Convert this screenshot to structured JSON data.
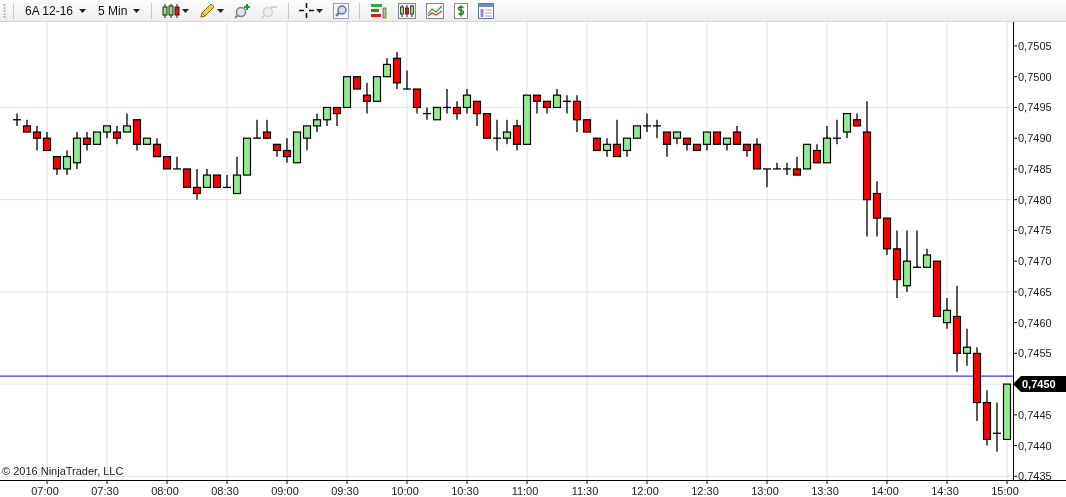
{
  "toolbar": {
    "instrument": {
      "label": "6A 12-16"
    },
    "interval": {
      "label": "5 Min"
    },
    "tool_groups": [
      [
        {
          "kind": "chart-style",
          "menu": true,
          "disabled": false
        },
        {
          "kind": "draw",
          "menu": true,
          "disabled": false
        },
        {
          "kind": "zoom-in",
          "menu": false,
          "disabled": false
        },
        {
          "kind": "zoom-out",
          "menu": false,
          "disabled": true
        }
      ],
      [
        {
          "kind": "crosshair",
          "menu": true,
          "disabled": false
        },
        {
          "kind": "zoom-box",
          "menu": false,
          "disabled": false
        }
      ],
      [
        {
          "kind": "indicators",
          "menu": false,
          "disabled": false
        },
        {
          "kind": "strategies",
          "menu": false,
          "disabled": false
        },
        {
          "kind": "line-chart",
          "menu": false,
          "disabled": false
        },
        {
          "kind": "dollar",
          "menu": false,
          "disabled": false
        },
        {
          "kind": "properties",
          "menu": false,
          "disabled": false
        }
      ]
    ]
  },
  "chart": {
    "copyright": "© 2016 NinjaTrader, LLC",
    "last_price": {
      "label": "0,7450"
    },
    "chart_data": {
      "type": "candlestick",
      "grid": true,
      "ylim": [
        0.74344,
        0.75089
      ],
      "yticks": [
        {
          "value": 0.7435,
          "label": "0,7435"
        },
        {
          "value": 0.744,
          "label": "0,7440"
        },
        {
          "value": 0.7445,
          "label": "0,7445"
        },
        {
          "value": 0.7455,
          "label": "0,7455"
        },
        {
          "value": 0.746,
          "label": "0,7460"
        },
        {
          "value": 0.7465,
          "label": "0,7465"
        },
        {
          "value": 0.747,
          "label": "0,7470"
        },
        {
          "value": 0.7475,
          "label": "0,7475"
        },
        {
          "value": 0.748,
          "label": "0,7480"
        },
        {
          "value": 0.7485,
          "label": "0,7485"
        },
        {
          "value": 0.749,
          "label": "0,7490"
        },
        {
          "value": 0.7495,
          "label": "0,7495"
        },
        {
          "value": 0.75,
          "label": "0,7500"
        },
        {
          "value": 0.7505,
          "label": "0,7505"
        }
      ],
      "categories": [
        null,
        null,
        null,
        "07:00",
        null,
        null,
        null,
        null,
        null,
        "07:30",
        null,
        null,
        null,
        null,
        null,
        "08:00",
        null,
        null,
        null,
        null,
        null,
        "08:30",
        null,
        null,
        null,
        null,
        null,
        "09:00",
        null,
        null,
        null,
        null,
        null,
        "09:30",
        null,
        null,
        null,
        null,
        null,
        "10:00",
        null,
        null,
        null,
        null,
        null,
        "10:30",
        null,
        null,
        null,
        null,
        null,
        "11:00",
        null,
        null,
        null,
        null,
        null,
        "11:30",
        null,
        null,
        null,
        null,
        null,
        "12:00",
        null,
        null,
        null,
        null,
        null,
        "12:30",
        null,
        null,
        null,
        null,
        null,
        "13:00",
        null,
        null,
        null,
        null,
        null,
        "13:30",
        null,
        null,
        null,
        null,
        null,
        "14:00",
        null,
        null,
        null,
        null,
        null,
        "14:30",
        null,
        null,
        null,
        null,
        null,
        "15:00"
      ],
      "ohlc": [
        [
          0.7493,
          0.7494,
          0.7492,
          0.7493
        ],
        [
          0.7492,
          0.7493,
          0.7491,
          0.7491
        ],
        [
          0.7491,
          0.7492,
          0.7488,
          0.749
        ],
        [
          0.749,
          0.7491,
          0.7488,
          0.7488
        ],
        [
          0.7487,
          0.7487,
          0.7484,
          0.7485
        ],
        [
          0.7485,
          0.7488,
          0.7484,
          0.7487
        ],
        [
          0.7486,
          0.7491,
          0.7485,
          0.749
        ],
        [
          0.749,
          0.7491,
          0.7488,
          0.7489
        ],
        [
          0.7489,
          0.7491,
          0.7489,
          0.7491
        ],
        [
          0.7491,
          0.7492,
          0.749,
          0.7492
        ],
        [
          0.7491,
          0.7492,
          0.7489,
          0.749
        ],
        [
          0.7491,
          0.7494,
          0.7491,
          0.7492
        ],
        [
          0.7493,
          0.7493,
          0.7488,
          0.7489
        ],
        [
          0.7489,
          0.749,
          0.7489,
          0.749
        ],
        [
          0.7489,
          0.749,
          0.7487,
          0.7487
        ],
        [
          0.7487,
          0.7487,
          0.7485,
          0.7485
        ],
        [
          0.7485,
          0.7487,
          0.7485,
          0.7485
        ],
        [
          0.7485,
          0.7485,
          0.7482,
          0.7482
        ],
        [
          0.7482,
          0.7485,
          0.748,
          0.7481
        ],
        [
          0.7482,
          0.7485,
          0.7482,
          0.7484
        ],
        [
          0.7484,
          0.7484,
          0.7482,
          0.7482
        ],
        [
          0.7482,
          0.7484,
          0.7482,
          0.7482
        ],
        [
          0.7481,
          0.7487,
          0.7481,
          0.7484
        ],
        [
          0.7484,
          0.749,
          0.7484,
          0.749
        ],
        [
          0.749,
          0.7493,
          0.749,
          0.749
        ],
        [
          0.7491,
          0.7493,
          0.749,
          0.749
        ],
        [
          0.7489,
          0.7489,
          0.7487,
          0.7488
        ],
        [
          0.7488,
          0.749,
          0.7486,
          0.7487
        ],
        [
          0.7486,
          0.7491,
          0.7486,
          0.7491
        ],
        [
          0.749,
          0.7492,
          0.7488,
          0.7492
        ],
        [
          0.7492,
          0.7494,
          0.7491,
          0.7493
        ],
        [
          0.7493,
          0.7495,
          0.7492,
          0.7495
        ],
        [
          0.7495,
          0.7495,
          0.7492,
          0.7494
        ],
        [
          0.7495,
          0.75,
          0.7495,
          0.75
        ],
        [
          0.75,
          0.75,
          0.7498,
          0.7498
        ],
        [
          0.7497,
          0.7499,
          0.7494,
          0.7496
        ],
        [
          0.7496,
          0.75,
          0.7496,
          0.75
        ],
        [
          0.75,
          0.7503,
          0.75,
          0.7502
        ],
        [
          0.7503,
          0.7504,
          0.7498,
          0.7499
        ],
        [
          0.7498,
          0.7501,
          0.7498,
          0.7498
        ],
        [
          0.7498,
          0.7498,
          0.7494,
          0.7495
        ],
        [
          0.7494,
          0.7495,
          0.7493,
          0.7494
        ],
        [
          0.7493,
          0.7495,
          0.7493,
          0.7495
        ],
        [
          0.7495,
          0.7498,
          0.7494,
          0.7495
        ],
        [
          0.7495,
          0.7496,
          0.7493,
          0.7494
        ],
        [
          0.7495,
          0.7498,
          0.7494,
          0.7497
        ],
        [
          0.7496,
          0.7496,
          0.7492,
          0.7494
        ],
        [
          0.7494,
          0.7494,
          0.749,
          0.749
        ],
        [
          0.749,
          0.7493,
          0.7488,
          0.749
        ],
        [
          0.749,
          0.7493,
          0.7489,
          0.7491
        ],
        [
          0.7492,
          0.7493,
          0.7488,
          0.7489
        ],
        [
          0.7489,
          0.7497,
          0.7489,
          0.7497
        ],
        [
          0.7497,
          0.7497,
          0.7494,
          0.7496
        ],
        [
          0.7496,
          0.7496,
          0.7494,
          0.7495
        ],
        [
          0.7495,
          0.7498,
          0.7495,
          0.7497
        ],
        [
          0.7496,
          0.7497,
          0.7494,
          0.7496
        ],
        [
          0.7496,
          0.7497,
          0.7491,
          0.7493
        ],
        [
          0.7493,
          0.7493,
          0.7491,
          0.7491
        ],
        [
          0.749,
          0.749,
          0.7488,
          0.7488
        ],
        [
          0.7488,
          0.749,
          0.7487,
          0.7489
        ],
        [
          0.7489,
          0.7493,
          0.7487,
          0.7487
        ],
        [
          0.7488,
          0.749,
          0.7487,
          0.749
        ],
        [
          0.749,
          0.7492,
          0.749,
          0.7492
        ],
        [
          0.7492,
          0.7494,
          0.7491,
          0.7492
        ],
        [
          0.7492,
          0.7493,
          0.749,
          0.7492
        ],
        [
          0.7491,
          0.7491,
          0.7487,
          0.7489
        ],
        [
          0.749,
          0.7491,
          0.7489,
          0.7491
        ],
        [
          0.749,
          0.749,
          0.7488,
          0.7489
        ],
        [
          0.7489,
          0.7489,
          0.7488,
          0.7488
        ],
        [
          0.7489,
          0.7491,
          0.7488,
          0.7491
        ],
        [
          0.7491,
          0.7491,
          0.7489,
          0.7489
        ],
        [
          0.7489,
          0.749,
          0.7488,
          0.749
        ],
        [
          0.7491,
          0.7492,
          0.7489,
          0.7489
        ],
        [
          0.7489,
          0.7489,
          0.7487,
          0.7488
        ],
        [
          0.7489,
          0.749,
          0.7485,
          0.7485
        ],
        [
          0.7485,
          0.7485,
          0.7482,
          0.7485
        ],
        [
          0.7485,
          0.7486,
          0.7485,
          0.7485
        ],
        [
          0.7485,
          0.7486,
          0.7484,
          0.7485
        ],
        [
          0.7485,
          0.7487,
          0.7484,
          0.7484
        ],
        [
          0.7485,
          0.7489,
          0.7485,
          0.7489
        ],
        [
          0.7488,
          0.7489,
          0.7486,
          0.7486
        ],
        [
          0.7486,
          0.7492,
          0.7486,
          0.749
        ],
        [
          0.749,
          0.7493,
          0.7489,
          0.749
        ],
        [
          0.7491,
          0.7494,
          0.749,
          0.7494
        ],
        [
          0.7493,
          0.7494,
          0.7492,
          0.7492
        ],
        [
          0.7491,
          0.7496,
          0.7474,
          0.748
        ],
        [
          0.7481,
          0.7483,
          0.7474,
          0.7477
        ],
        [
          0.7477,
          0.7477,
          0.7471,
          0.7472
        ],
        [
          0.7472,
          0.7475,
          0.7464,
          0.7467
        ],
        [
          0.7466,
          0.7475,
          0.7465,
          0.747
        ],
        [
          0.7469,
          0.7475,
          0.7469,
          0.7469
        ],
        [
          0.7469,
          0.7472,
          0.7469,
          0.7471
        ],
        [
          0.747,
          0.747,
          0.7461,
          0.7461
        ],
        [
          0.746,
          0.7464,
          0.7459,
          0.7462
        ],
        [
          0.7461,
          0.7466,
          0.7452,
          0.7455
        ],
        [
          0.7455,
          0.7459,
          0.7453,
          0.7456
        ],
        [
          0.7455,
          0.7456,
          0.7444,
          0.7447
        ],
        [
          0.7447,
          0.7449,
          0.744,
          0.7441
        ],
        [
          0.7442,
          0.7447,
          0.7439,
          0.7442
        ],
        [
          0.7441,
          0.745,
          0.7441,
          0.745
        ]
      ],
      "ref_lines": [
        {
          "axis": "y",
          "value": 0.74513,
          "color": "#0000ff"
        }
      ]
    }
  }
}
